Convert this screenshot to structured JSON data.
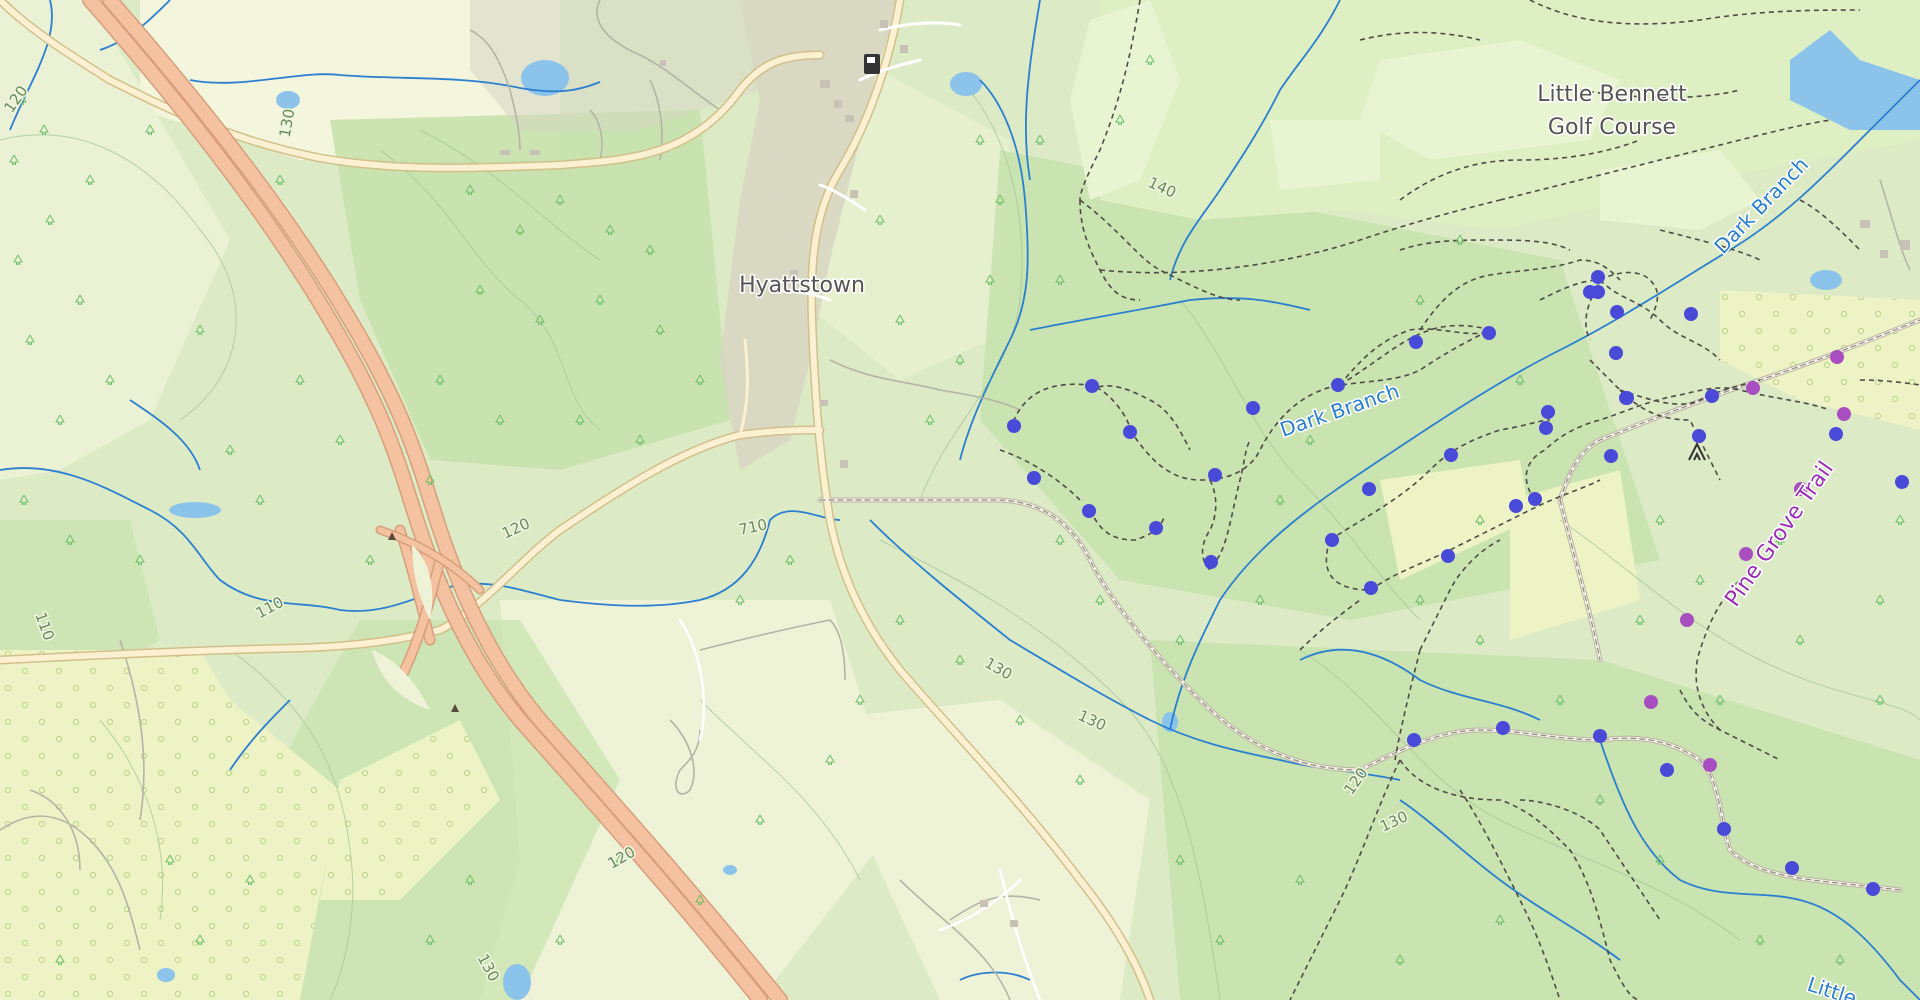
{
  "map": {
    "places": {
      "town": "Hyattstown",
      "golf_course_line1": "Little Bennett",
      "golf_course_line2": "Golf Course"
    },
    "water": {
      "dark_branch_1": "Dark Branch",
      "dark_branch_2": "Dark Branch",
      "little_creek_partial": "Little"
    },
    "trails": {
      "pine_grove": "Pine Grove Trail"
    },
    "contours": {
      "c120_topleft": "120",
      "c130_topleft": "130",
      "c140": "140",
      "c120_road": "120",
      "c710": "710",
      "c110_left": "110",
      "c110_mid": "110",
      "c130_creek": "130",
      "c130_creek2": "130",
      "c120_right": "120",
      "c130_right": "130",
      "c120_highway": "120",
      "c130_bottom": "130"
    },
    "colors": {
      "forest": "#cfe6b8",
      "open_land": "#eef3d8",
      "water": "#8cc3ea",
      "stream": "#2b7fd0",
      "highway": "#f4c2a0",
      "road": "#fbf1d2",
      "trail_marker_blue": "#4a4ad8",
      "trail_marker_purple": "#a84ec0",
      "label_blue": "#2b7fd0",
      "label_purple": "#9b2fb5"
    },
    "icons": [
      "fuel-station-icon",
      "campsite-icon",
      "tree-icon"
    ]
  }
}
